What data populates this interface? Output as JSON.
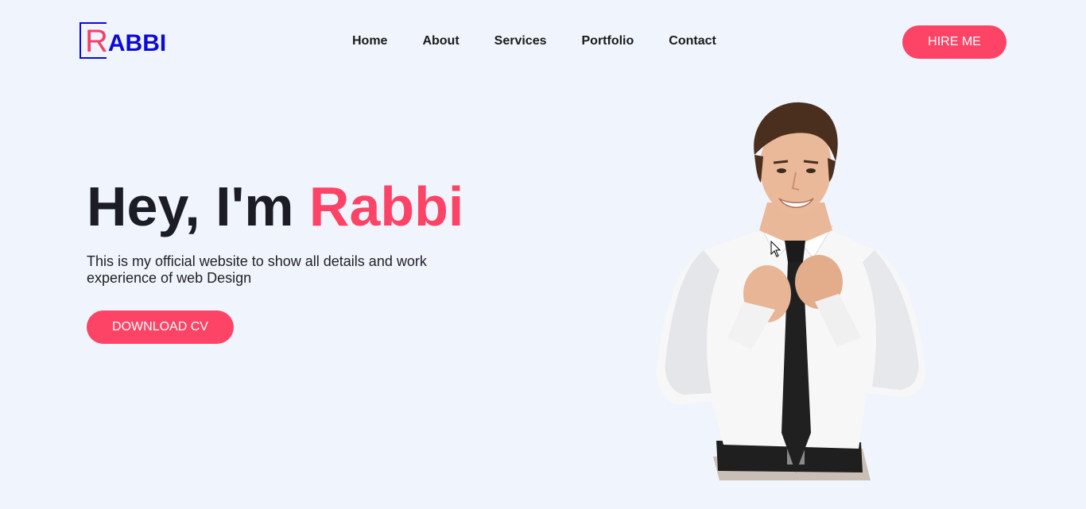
{
  "brand": {
    "logo_initial": "R",
    "logo_rest": "ABBI"
  },
  "nav": {
    "items": [
      "Home",
      "About",
      "Services",
      "Portfolio",
      "Contact"
    ]
  },
  "header": {
    "cta_label": "HIRE ME"
  },
  "hero": {
    "title_prefix": "Hey, I'm ",
    "title_name": "Rabbi",
    "description": "This is my official website to show all details and work experience of web Design",
    "download_label": "DOWNLOAD CV",
    "portrait": "man-in-white-shirt-adjusting-black-tie"
  },
  "colors": {
    "background": "#f0f4fd",
    "accent": "#fd4466",
    "logo_blue": "#0b0bd8",
    "heading": "#1c1d24"
  }
}
